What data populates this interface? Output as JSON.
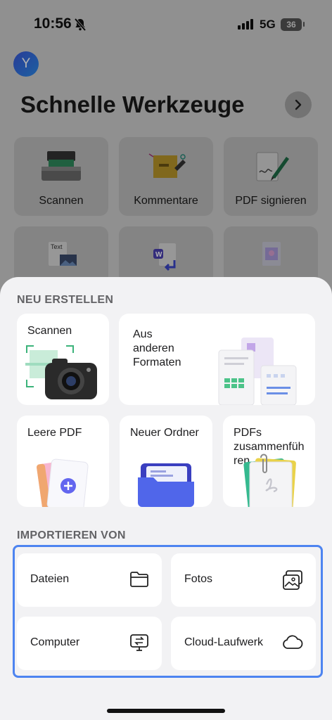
{
  "status_bar": {
    "time": "10:56",
    "network": "5G",
    "battery": "36"
  },
  "avatar": {
    "initial": "Y"
  },
  "quick_tools": {
    "title": "Schnelle Werkzeuge",
    "items": [
      {
        "label": "Scannen",
        "icon": "scanner-icon"
      },
      {
        "label": "Kommentare",
        "icon": "sticky-note-icon"
      },
      {
        "label": "PDF signieren",
        "icon": "signature-pen-icon"
      },
      {
        "label": "",
        "icon": "image-to-text-icon"
      },
      {
        "label": "",
        "icon": "word-convert-icon"
      },
      {
        "label": "",
        "icon": "image-document-icon"
      }
    ]
  },
  "new_section": {
    "title": "NEU ERSTELLEN",
    "items": [
      {
        "label": "Scannen",
        "icon": "camera-icon"
      },
      {
        "label": "Aus\nanderen\nFormaten",
        "icon": "documents-formats-icon"
      },
      {
        "label": "Leere PDF",
        "icon": "blank-pdf-icon"
      },
      {
        "label": "Neuer Ordner",
        "icon": "folder-icon"
      },
      {
        "label": "PDFs\nzusammenfüh\nren",
        "icon": "merge-pdf-icon"
      }
    ]
  },
  "import_section": {
    "title": "IMPORTIEREN VON",
    "items": [
      {
        "label": "Dateien",
        "icon": "folder-outline-icon"
      },
      {
        "label": "Fotos",
        "icon": "photos-icon"
      },
      {
        "label": "Computer",
        "icon": "computer-transfer-icon"
      },
      {
        "label": "Cloud-Laufwerk",
        "icon": "cloud-icon"
      }
    ]
  },
  "colors": {
    "highlight_border": "#4d84f0",
    "accent": "#5a63e8",
    "sheet_bg": "#f2f2f4"
  }
}
